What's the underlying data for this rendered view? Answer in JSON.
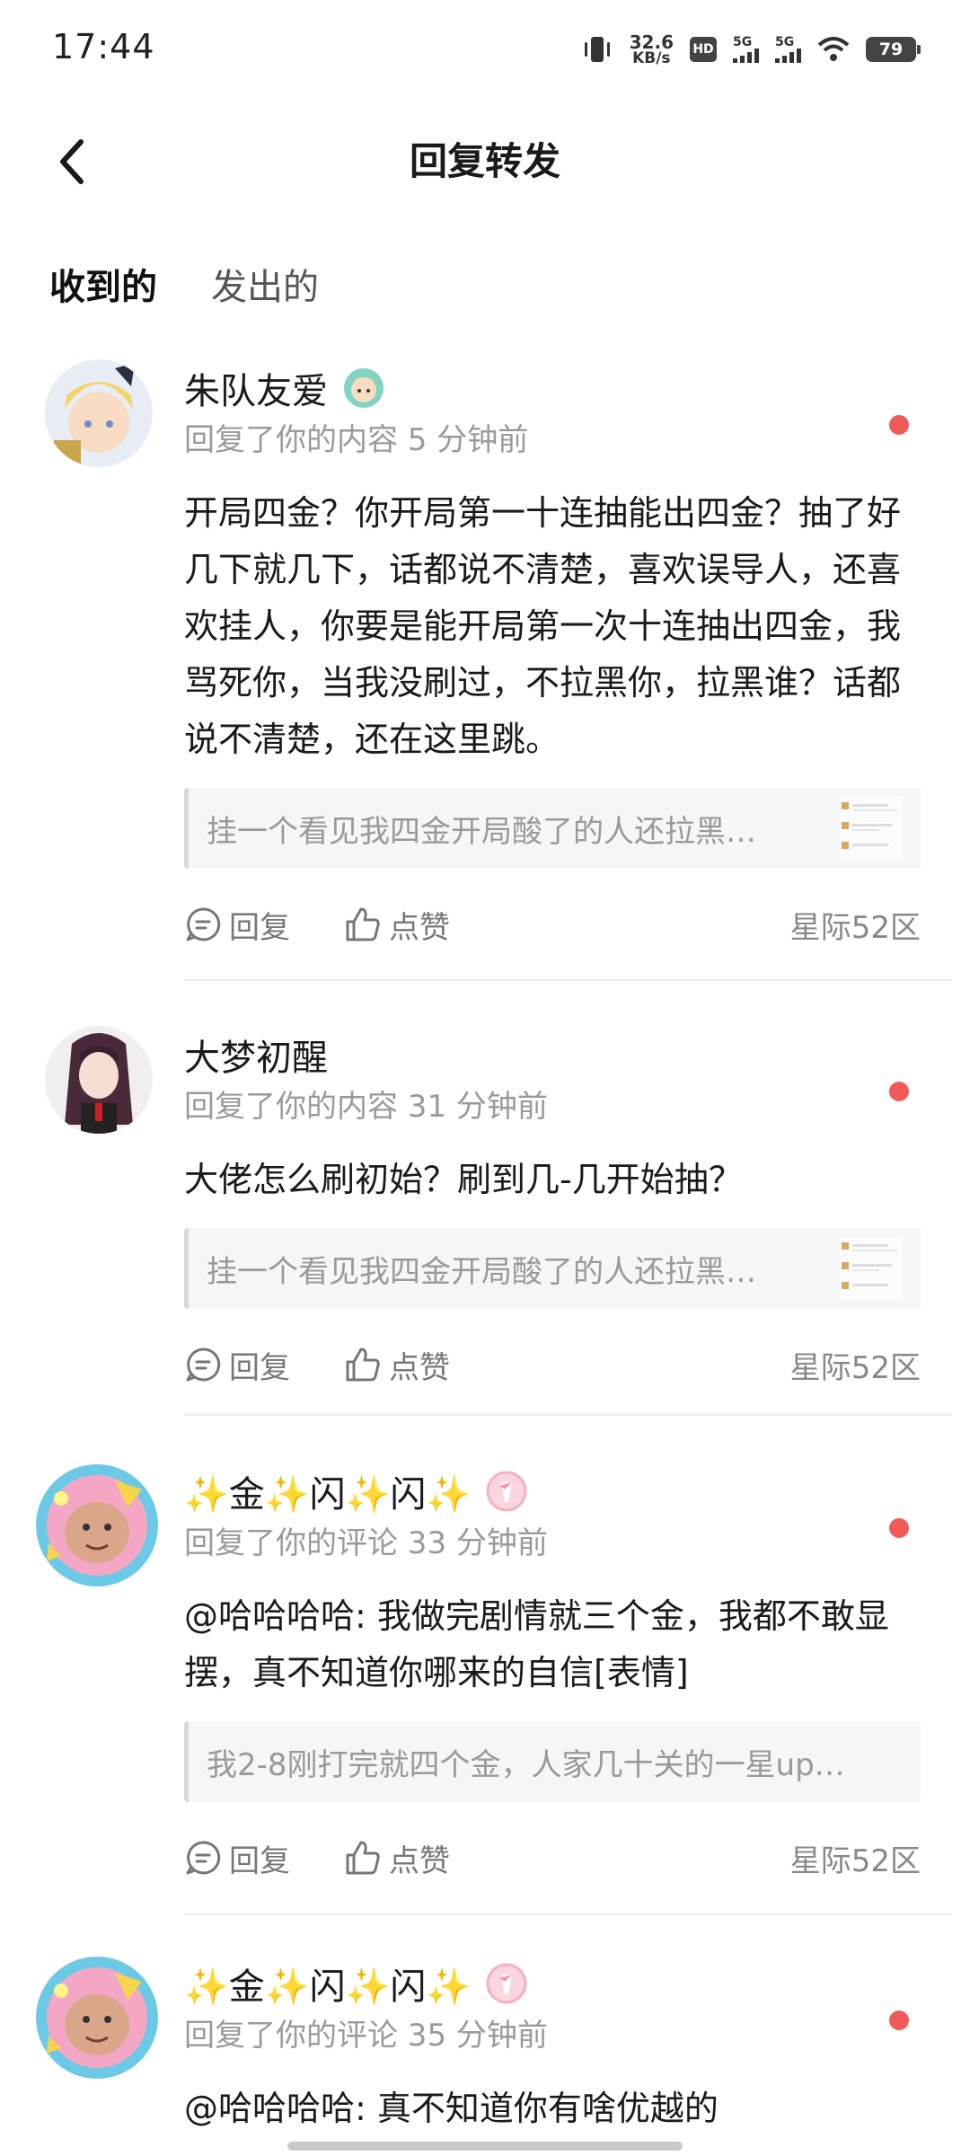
{
  "status_bar": {
    "time": "17:44",
    "net_speed_value": "32.6",
    "net_speed_unit": "KB/s",
    "hd_label": "HD",
    "sim1_label": "5G",
    "sim2_label": "5G",
    "battery_level": "79"
  },
  "header": {
    "title": "回复转发"
  },
  "tabs": [
    {
      "label": "收到的",
      "active": true
    },
    {
      "label": "发出的",
      "active": false
    }
  ],
  "colors": {
    "accent": "#2fd1c0",
    "unread": "#f25a5a"
  },
  "items": [
    {
      "username": "朱队友爱",
      "meta": "回复了你的内容 5 分钟前",
      "body": "开局四金？你开局第一十连抽能出四金？抽了好几下就几下，话都说不清楚，喜欢误导人，还喜欢挂人，你要是能开局第一次十连抽出四金，我骂死你，当我没刷过，不拉黑你，拉黑谁？话都说不清楚，还在这里跳。",
      "quote": "挂一个看见我四金开局酸了的人还拉黑…",
      "reply_label": "回复",
      "like_label": "点赞",
      "zone": "星际52区"
    },
    {
      "username": "大梦初醒",
      "meta": "回复了你的内容 31 分钟前",
      "body": "大佬怎么刷初始？刷到几-几开始抽？",
      "quote": "挂一个看见我四金开局酸了的人还拉黑…",
      "reply_label": "回复",
      "like_label": "点赞",
      "zone": "星际52区"
    },
    {
      "username": "✨金✨闪✨闪✨",
      "meta": "回复了你的评论 33 分钟前",
      "body": "@哈哈哈哈: 我做完剧情就三个金，我都不敢显摆，真不知道你哪来的自信[表情]",
      "quote": "我2-8刚打完就四个金，人家几十关的一星up…",
      "reply_label": "回复",
      "like_label": "点赞",
      "zone": "星际52区"
    },
    {
      "username": "✨金✨闪✨闪✨",
      "meta": "回复了你的评论 35 分钟前",
      "body": "@哈哈哈哈: 真不知道你有啥优越的"
    }
  ]
}
